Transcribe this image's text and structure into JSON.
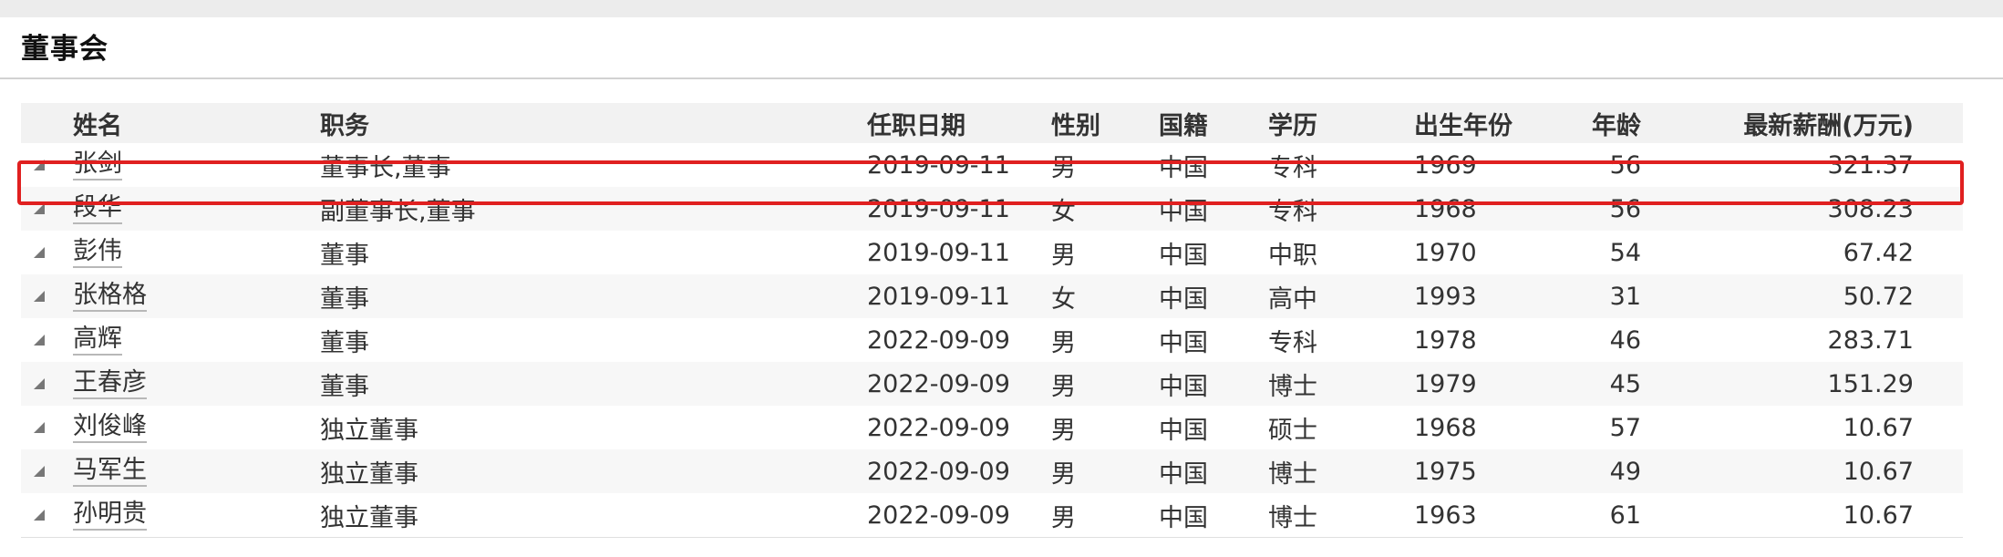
{
  "panel": {
    "title": "董事会"
  },
  "table": {
    "columns": [
      "姓名",
      "职务",
      "任职日期",
      "性别",
      "国籍",
      "学历",
      "出生年份",
      "年龄",
      "最新薪酬(万元)"
    ],
    "rows": [
      {
        "name": "张剑",
        "title": "董事长,董事",
        "date": "2019-09-11",
        "gender": "男",
        "nation": "中国",
        "edu": "专科",
        "birth": "1969",
        "age": "56",
        "salary": "321.37"
      },
      {
        "name": "段华",
        "title": "副董事长,董事",
        "date": "2019-09-11",
        "gender": "女",
        "nation": "中国",
        "edu": "专科",
        "birth": "1968",
        "age": "56",
        "salary": "308.23"
      },
      {
        "name": "彭伟",
        "title": "董事",
        "date": "2019-09-11",
        "gender": "男",
        "nation": "中国",
        "edu": "中职",
        "birth": "1970",
        "age": "54",
        "salary": "67.42"
      },
      {
        "name": "张格格",
        "title": "董事",
        "date": "2019-09-11",
        "gender": "女",
        "nation": "中国",
        "edu": "高中",
        "birth": "1993",
        "age": "31",
        "salary": "50.72"
      },
      {
        "name": "高辉",
        "title": "董事",
        "date": "2022-09-09",
        "gender": "男",
        "nation": "中国",
        "edu": "专科",
        "birth": "1978",
        "age": "46",
        "salary": "283.71"
      },
      {
        "name": "王春彦",
        "title": "董事",
        "date": "2022-09-09",
        "gender": "男",
        "nation": "中国",
        "edu": "博士",
        "birth": "1979",
        "age": "45",
        "salary": "151.29"
      },
      {
        "name": "刘俊峰",
        "title": "独立董事",
        "date": "2022-09-09",
        "gender": "男",
        "nation": "中国",
        "edu": "硕士",
        "birth": "1968",
        "age": "57",
        "salary": "10.67"
      },
      {
        "name": "马军生",
        "title": "独立董事",
        "date": "2022-09-09",
        "gender": "男",
        "nation": "中国",
        "edu": "博士",
        "birth": "1975",
        "age": "49",
        "salary": "10.67"
      },
      {
        "name": "孙明贵",
        "title": "独立董事",
        "date": "2022-09-09",
        "gender": "男",
        "nation": "中国",
        "edu": "博士",
        "birth": "1963",
        "age": "61",
        "salary": "10.67"
      }
    ]
  },
  "icons": {
    "row_expand": "expand-triangle-icon"
  },
  "colors": {
    "highlight": "#e02020",
    "header_bg": "#f2f2f2",
    "stripe_bg": "#f7f7f7"
  }
}
